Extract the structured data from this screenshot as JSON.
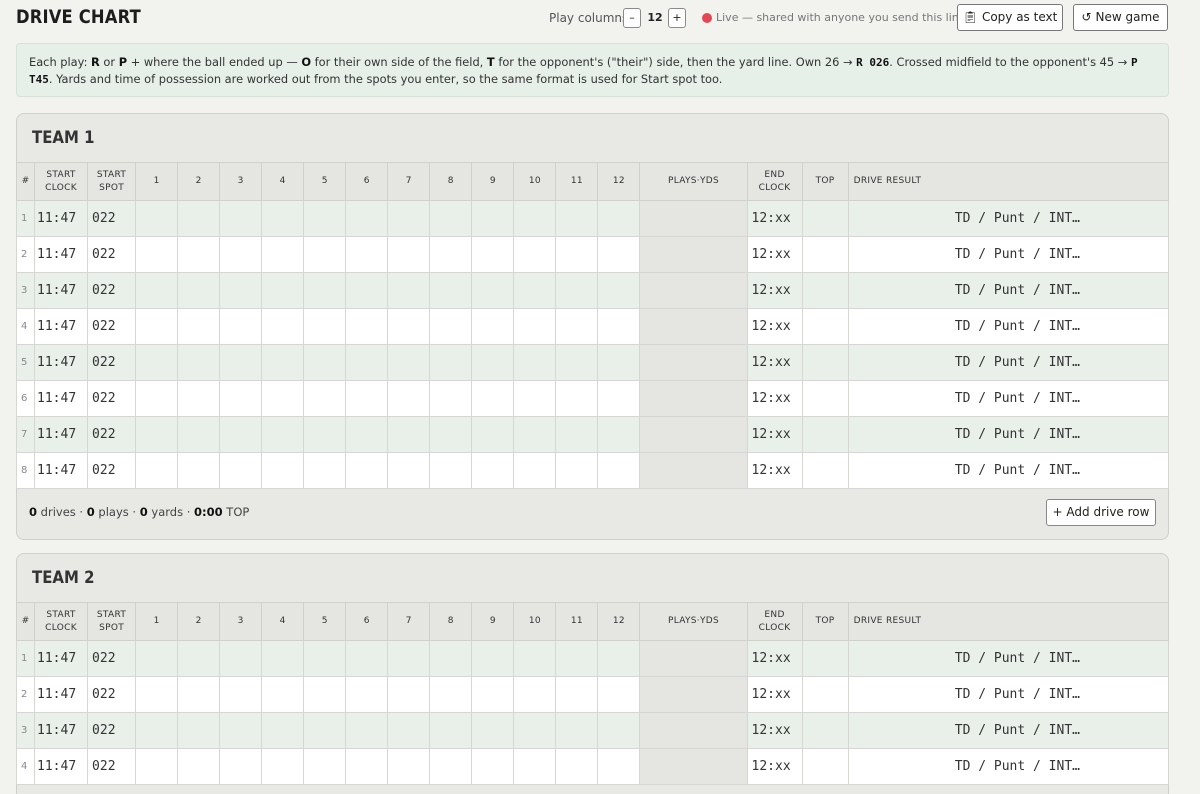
{
  "header": {
    "title": "DRIVE CHART",
    "play_columns_label": "Play columns",
    "minus": "–",
    "plus": "+",
    "play_columns_value": "12",
    "live_text": "Live — shared with anyone you send this link to",
    "copy_label": "Copy as text",
    "new_game_label": "New game",
    "live_color": "#e64653"
  },
  "info": {
    "p1": "Each play: ",
    "R": "R",
    "p2": " or ",
    "P": "P",
    "p3": " + where the ball ended up — ",
    "O": "O",
    "p4": " for their own side of the field, ",
    "T": "T",
    "p5": " for the opponent's (\"their\") side, then the yard line. Own 26 → ",
    "ex1": "R 026",
    "p6": ". Crossed midfield to the opponent's 45 → ",
    "ex2": "P T45",
    "p7": ". Yards and time of possession are worked out from the spots you enter, so the same format is used for Start spot too."
  },
  "columns": {
    "hash": "#",
    "start": "START",
    "clock": "CLOCK",
    "spot": "SPOT",
    "plays": [
      "1",
      "2",
      "3",
      "4",
      "5",
      "6",
      "7",
      "8",
      "9",
      "10",
      "11",
      "12"
    ],
    "plays_yds": "PLAYS·YDS",
    "end": "END",
    "end_clock": "CLOCK",
    "top": "TOP",
    "result": "DRIVE RESULT"
  },
  "team1": {
    "name": "TEAM 1",
    "rows": [
      {
        "n": "1",
        "clock": "11:47",
        "spot": "022",
        "end": "12:xx",
        "result": "TD / Punt / INT…"
      },
      {
        "n": "2",
        "clock": "11:47",
        "spot": "022",
        "end": "12:xx",
        "result": "TD / Punt / INT…"
      },
      {
        "n": "3",
        "clock": "11:47",
        "spot": "022",
        "end": "12:xx",
        "result": "TD / Punt / INT…"
      },
      {
        "n": "4",
        "clock": "11:47",
        "spot": "022",
        "end": "12:xx",
        "result": "TD / Punt / INT…"
      },
      {
        "n": "5",
        "clock": "11:47",
        "spot": "022",
        "end": "12:xx",
        "result": "TD / Punt / INT…"
      },
      {
        "n": "6",
        "clock": "11:47",
        "spot": "022",
        "end": "12:xx",
        "result": "TD / Punt / INT…"
      },
      {
        "n": "7",
        "clock": "11:47",
        "spot": "022",
        "end": "12:xx",
        "result": "TD / Punt / INT…"
      },
      {
        "n": "8",
        "clock": "11:47",
        "spot": "022",
        "end": "12:xx",
        "result": "TD / Punt / INT…"
      }
    ],
    "summary": {
      "drives_n": "0",
      "drives_label": " drives · ",
      "plays_n": "0",
      "plays_label": " plays · ",
      "yards_n": "0",
      "yards_label": " yards · ",
      "top_n": "0:00",
      "top_label": " TOP"
    },
    "add_label": "+ Add drive row"
  },
  "team2": {
    "name": "TEAM 2",
    "rows": [
      {
        "n": "1",
        "clock": "11:47",
        "spot": "022",
        "end": "12:xx",
        "result": "TD / Punt / INT…"
      },
      {
        "n": "2",
        "clock": "11:47",
        "spot": "022",
        "end": "12:xx",
        "result": "TD / Punt / INT…"
      },
      {
        "n": "3",
        "clock": "11:47",
        "spot": "022",
        "end": "12:xx",
        "result": "TD / Punt / INT…"
      },
      {
        "n": "4",
        "clock": "11:47",
        "spot": "022",
        "end": "12:xx",
        "result": "TD / Punt / INT…"
      }
    ]
  }
}
